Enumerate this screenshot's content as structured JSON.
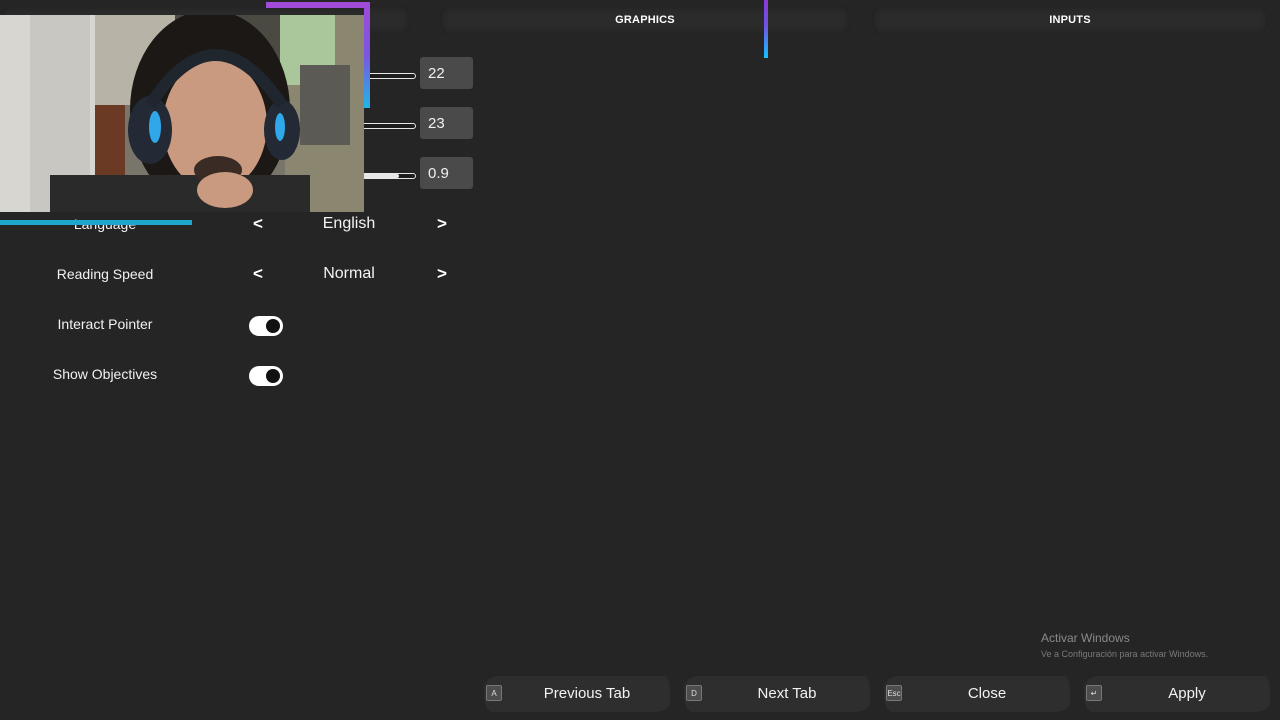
{
  "tabs": [
    {
      "label": "GRAPHICS"
    },
    {
      "label": "INPUTS"
    }
  ],
  "settings": {
    "slider1": {
      "value": "22",
      "fill": 0.62
    },
    "slider2": {
      "value": "23",
      "fill": 0.66
    },
    "slider3": {
      "value": "0.9",
      "fill": 0.9
    },
    "language": {
      "label": "Language",
      "value": "English"
    },
    "reading_speed": {
      "label": "Reading Speed",
      "value": "Normal"
    },
    "interact_pointer": {
      "label": "Interact Pointer",
      "on": true
    },
    "show_objectives": {
      "label": "Show Objectives",
      "on": true
    }
  },
  "arrows": {
    "left": "<",
    "right": ">"
  },
  "footer": {
    "prev": {
      "key": "A",
      "label": "Previous Tab"
    },
    "next": {
      "key": "D",
      "label": "Next Tab"
    },
    "close": {
      "key": "Esc",
      "label": "Close"
    },
    "apply": {
      "key": "↵",
      "label": "Apply"
    }
  },
  "watermark": {
    "title": "Activar Windows",
    "subtitle": "Ve a Configuración para activar Windows."
  },
  "colors": {
    "background": "#252525",
    "accent_purple": "#a14bd8",
    "accent_cyan": "#14c2ff"
  }
}
